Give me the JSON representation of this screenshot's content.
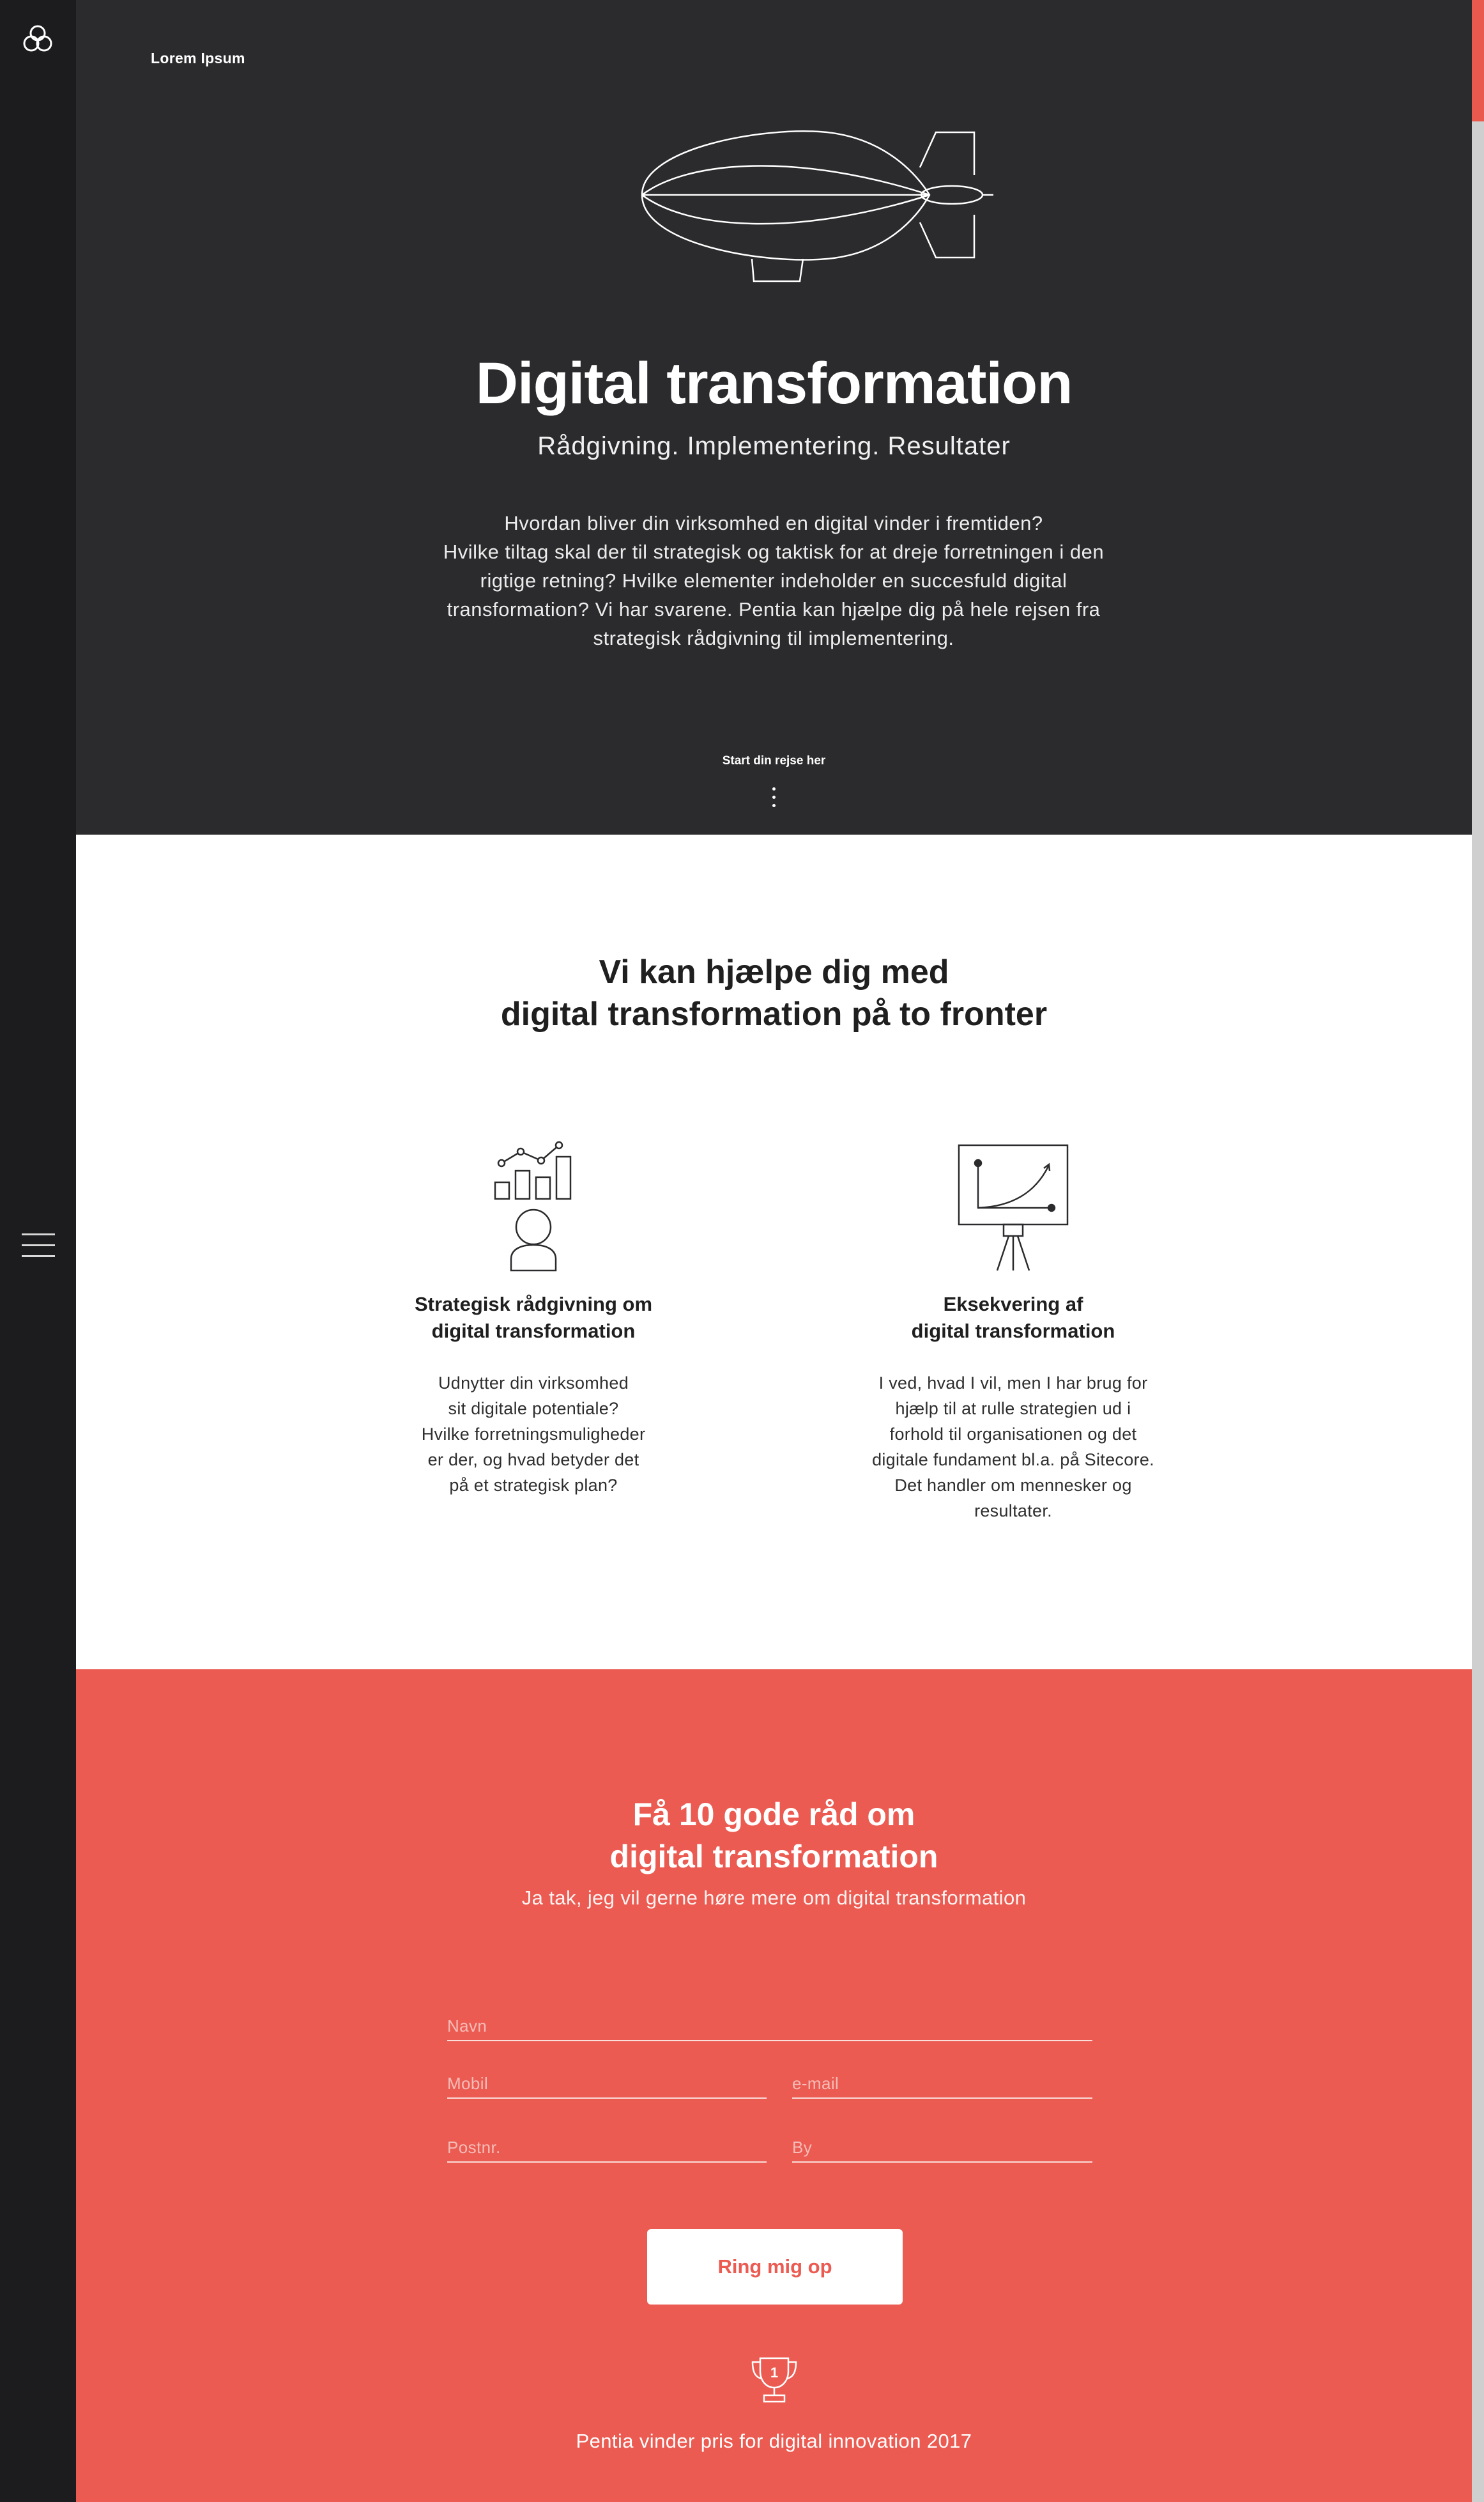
{
  "sidebar": {
    "logo_icon": "knot-logo-icon",
    "menu_icon": "hamburger-menu-icon"
  },
  "hero": {
    "brand": "Lorem Ipsum",
    "illustration": "blimp-icon",
    "title": "Digital transformation",
    "tagline": "Rådgivning. Implementering. Resultater",
    "intro_lines": [
      "Hvordan bliver din virksomhed en digital vinder i fremtiden?",
      "Hvilke tiltag skal der til strategisk og taktisk for at dreje forretningen i den",
      "rigtige retning? Hvilke elementer indeholder en succesfuld digital",
      "transformation? Vi har svarene. Pentia kan hjælpe dig på hele rejsen fra",
      "strategisk rådgivning til implementering."
    ],
    "cta": "Start din rejse her"
  },
  "services": {
    "heading_lines": [
      "Vi kan hjælpe dig med",
      "digital transformation på to fronter"
    ],
    "items": [
      {
        "icon": "strategy-chart-person-icon",
        "title_lines": [
          "Strategisk rådgivning om",
          "digital transformation"
        ],
        "body_lines": [
          "Udnytter din virksomhed",
          "sit digitale potentiale?",
          "Hvilke forretningsmuligheder",
          "er der, og hvad betyder det",
          "på et strategisk plan?"
        ]
      },
      {
        "icon": "presentation-board-icon",
        "title_lines": [
          "Eksekvering af",
          "digital transformation"
        ],
        "body_lines": [
          "I ved, hvad I vil, men I har brug for",
          "hjælp til at rulle strategien ud i",
          "forhold til organisationen og det",
          "digitale fundament bl.a. på Sitecore.",
          "Det handler om mennesker og",
          "resultater."
        ]
      }
    ]
  },
  "lead": {
    "heading_lines": [
      "Få 10 gode råd om",
      "digital transformation"
    ],
    "subtitle": "Ja tak, jeg vil gerne høre mere om digital transformation",
    "form": {
      "name_placeholder": "Navn",
      "mobile_placeholder": "Mobil",
      "email_placeholder": "e-mail",
      "zip_placeholder": "Postnr.",
      "city_placeholder": "By",
      "submit_label": "Ring mig op"
    },
    "award_icon": "trophy-icon",
    "award_text": "Pentia vinder pris for digital innovation 2017"
  },
  "colors": {
    "hero_bg": "#2b2b2d",
    "sidebar_bg": "#1c1c1e",
    "accent": "#eb5b52",
    "white": "#ffffff"
  }
}
